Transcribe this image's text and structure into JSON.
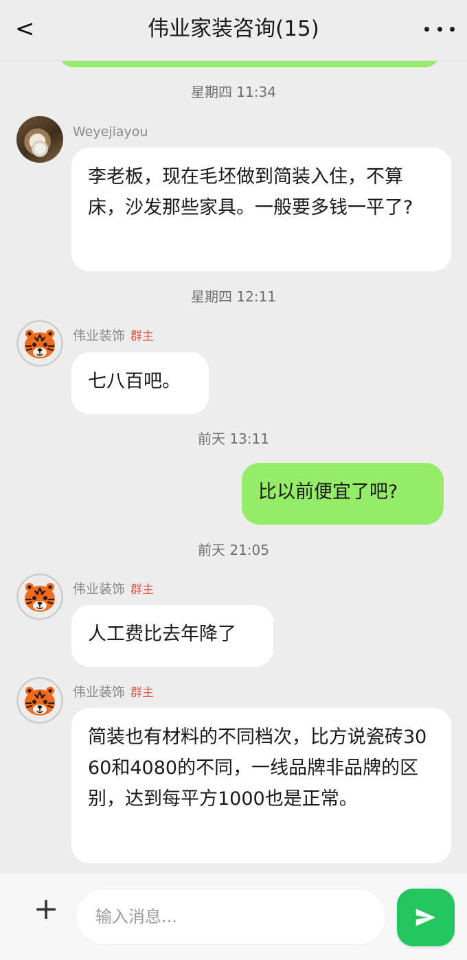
{
  "header": {
    "back_label": "<",
    "title": "伟业家装咨询(15)"
  },
  "messages": [
    {
      "time": "星期四 11:34",
      "sender": "Weyejiayou",
      "text": "李老板，现在毛坯做到简装入住，不算床，沙发那些家具。一般要多钱一平了?"
    },
    {
      "time": "星期四 12:11",
      "sender": "伟业装饰",
      "badge": "群主",
      "text": "七八百吧。"
    },
    {
      "time": "前天 13:11",
      "text": "比以前便宜了吧?"
    },
    {
      "time": "前天 21:05",
      "sender": "伟业装饰",
      "badge": "群主",
      "text": "人工费比去年降了"
    },
    {
      "sender": "伟业装饰",
      "badge": "群主",
      "text": "简装也有材料的不同档次，比方说瓷砖3060和4080的不同，一线品牌非品牌的区别，达到每平方1000也是正常。"
    }
  ],
  "composer": {
    "placeholder": "输入消息..."
  },
  "icons": {
    "more": "more-dots-icon",
    "add": "plus-icon",
    "send": "send-icon"
  },
  "colors": {
    "background": "#ededed",
    "my_bubble": "#95ec69",
    "other_bubble": "#ffffff",
    "owner_badge": "#e2534a",
    "send_button": "#22c55e"
  }
}
